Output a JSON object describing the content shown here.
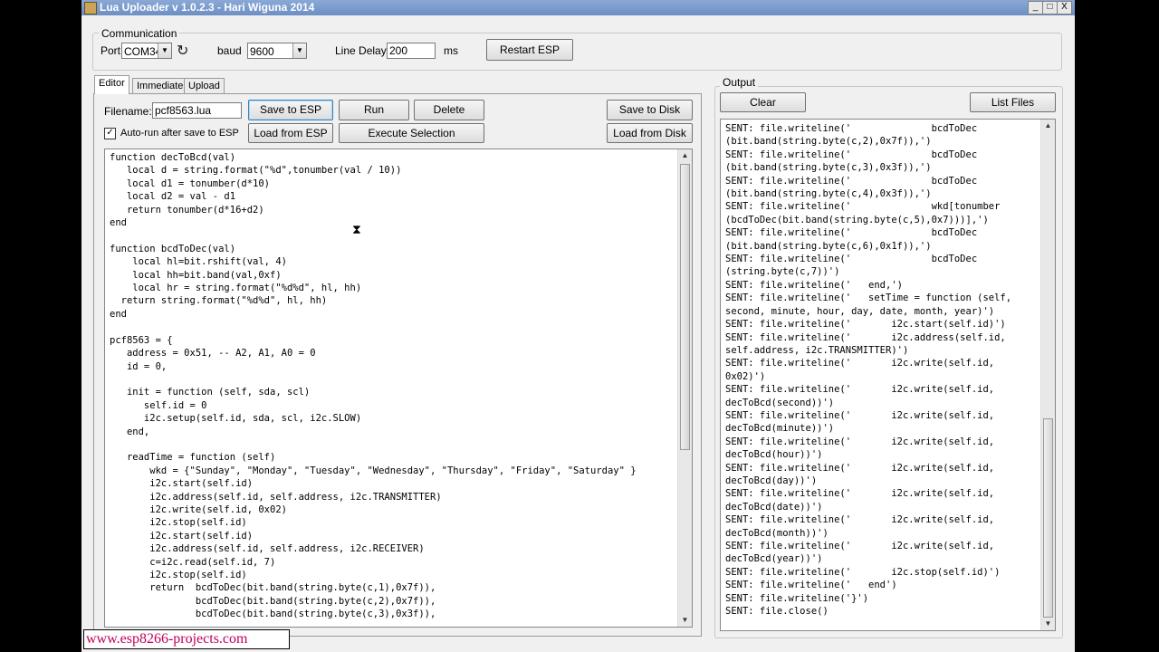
{
  "window": {
    "title": "Lua Uploader v 1.0.2.3 - Hari Wiguna 2014",
    "minimize": "_",
    "maximize": "□",
    "close": "X"
  },
  "communication": {
    "group_label": "Communication",
    "port_label": "Port",
    "port_value": "COM34",
    "baud_label": "baud",
    "baud_value": "9600",
    "line_delay_label": "Line Delay",
    "line_delay_value": "200",
    "ms_label": "ms",
    "restart_button": "Restart ESP"
  },
  "tabs": [
    {
      "label": "Editor"
    },
    {
      "label": "Immediate"
    },
    {
      "label": "Upload"
    }
  ],
  "editor": {
    "filename_label": "Filename:",
    "filename_value": "pcf8563.lua",
    "save_to_esp": "Save to ESP",
    "run": "Run",
    "delete": "Delete",
    "save_to_disk": "Save to Disk",
    "autorun_label": "Auto-run after save to ESP",
    "autorun_checked": "✓",
    "load_from_esp": "Load from ESP",
    "execute_selection": "Execute Selection",
    "load_from_disk": "Load from Disk",
    "code": "function decToBcd(val)\n   local d = string.format(\"%d\",tonumber(val / 10))\n   local d1 = tonumber(d*10)\n   local d2 = val - d1\n   return tonumber(d*16+d2)\nend\n\nfunction bcdToDec(val)\n    local hl=bit.rshift(val, 4)\n    local hh=bit.band(val,0xf)\n    local hr = string.format(\"%d%d\", hl, hh)\n  return string.format(\"%d%d\", hl, hh)\nend\n\npcf8563 = {\n   address = 0x51, -- A2, A1, A0 = 0\n   id = 0,\n\n   init = function (self, sda, scl)\n      self.id = 0\n      i2c.setup(self.id, sda, scl, i2c.SLOW)\n   end,\n\n   readTime = function (self)\n       wkd = {\"Sunday\", \"Monday\", \"Tuesday\", \"Wednesday\", \"Thursday\", \"Friday\", \"Saturday\" }\n       i2c.start(self.id)\n       i2c.address(self.id, self.address, i2c.TRANSMITTER)\n       i2c.write(self.id, 0x02)\n       i2c.stop(self.id)\n       i2c.start(self.id)\n       i2c.address(self.id, self.address, i2c.RECEIVER)\n       c=i2c.read(self.id, 7)\n       i2c.stop(self.id)\n       return  bcdToDec(bit.band(string.byte(c,1),0x7f)),\n               bcdToDec(bit.band(string.byte(c,2),0x7f)),\n               bcdToDec(bit.band(string.byte(c,3),0x3f)),"
  },
  "output": {
    "group_label": "Output",
    "clear": "Clear",
    "list_files": "List Files",
    "log": "SENT: file.writeline('              bcdToDec\n(bit.band(string.byte(c,2),0x7f)),')\nSENT: file.writeline('              bcdToDec\n(bit.band(string.byte(c,3),0x3f)),')\nSENT: file.writeline('              bcdToDec\n(bit.band(string.byte(c,4),0x3f)),')\nSENT: file.writeline('              wkd[tonumber\n(bcdToDec(bit.band(string.byte(c,5),0x7)))],')\nSENT: file.writeline('              bcdToDec\n(bit.band(string.byte(c,6),0x1f)),')\nSENT: file.writeline('              bcdToDec\n(string.byte(c,7))')\nSENT: file.writeline('   end,')\nSENT: file.writeline('   setTime = function (self,\nsecond, minute, hour, day, date, month, year)')\nSENT: file.writeline('       i2c.start(self.id)')\nSENT: file.writeline('       i2c.address(self.id,\nself.address, i2c.TRANSMITTER)')\nSENT: file.writeline('       i2c.write(self.id,\n0x02)')\nSENT: file.writeline('       i2c.write(self.id,\ndecToBcd(second))')\nSENT: file.writeline('       i2c.write(self.id,\ndecToBcd(minute))')\nSENT: file.writeline('       i2c.write(self.id,\ndecToBcd(hour))')\nSENT: file.writeline('       i2c.write(self.id,\ndecToBcd(day))')\nSENT: file.writeline('       i2c.write(self.id,\ndecToBcd(date))')\nSENT: file.writeline('       i2c.write(self.id,\ndecToBcd(month))')\nSENT: file.writeline('       i2c.write(self.id,\ndecToBcd(year))')\nSENT: file.writeline('       i2c.stop(self.id)')\nSENT: file.writeline('   end')\nSENT: file.writeline('}')\nSENT: file.close()"
  },
  "overlay": {
    "watermark": "www.esp8266-projects.com",
    "cursor": "⧗"
  },
  "colors": {
    "watermark": "#c2005b",
    "titlebar": "#7b9bcd"
  }
}
